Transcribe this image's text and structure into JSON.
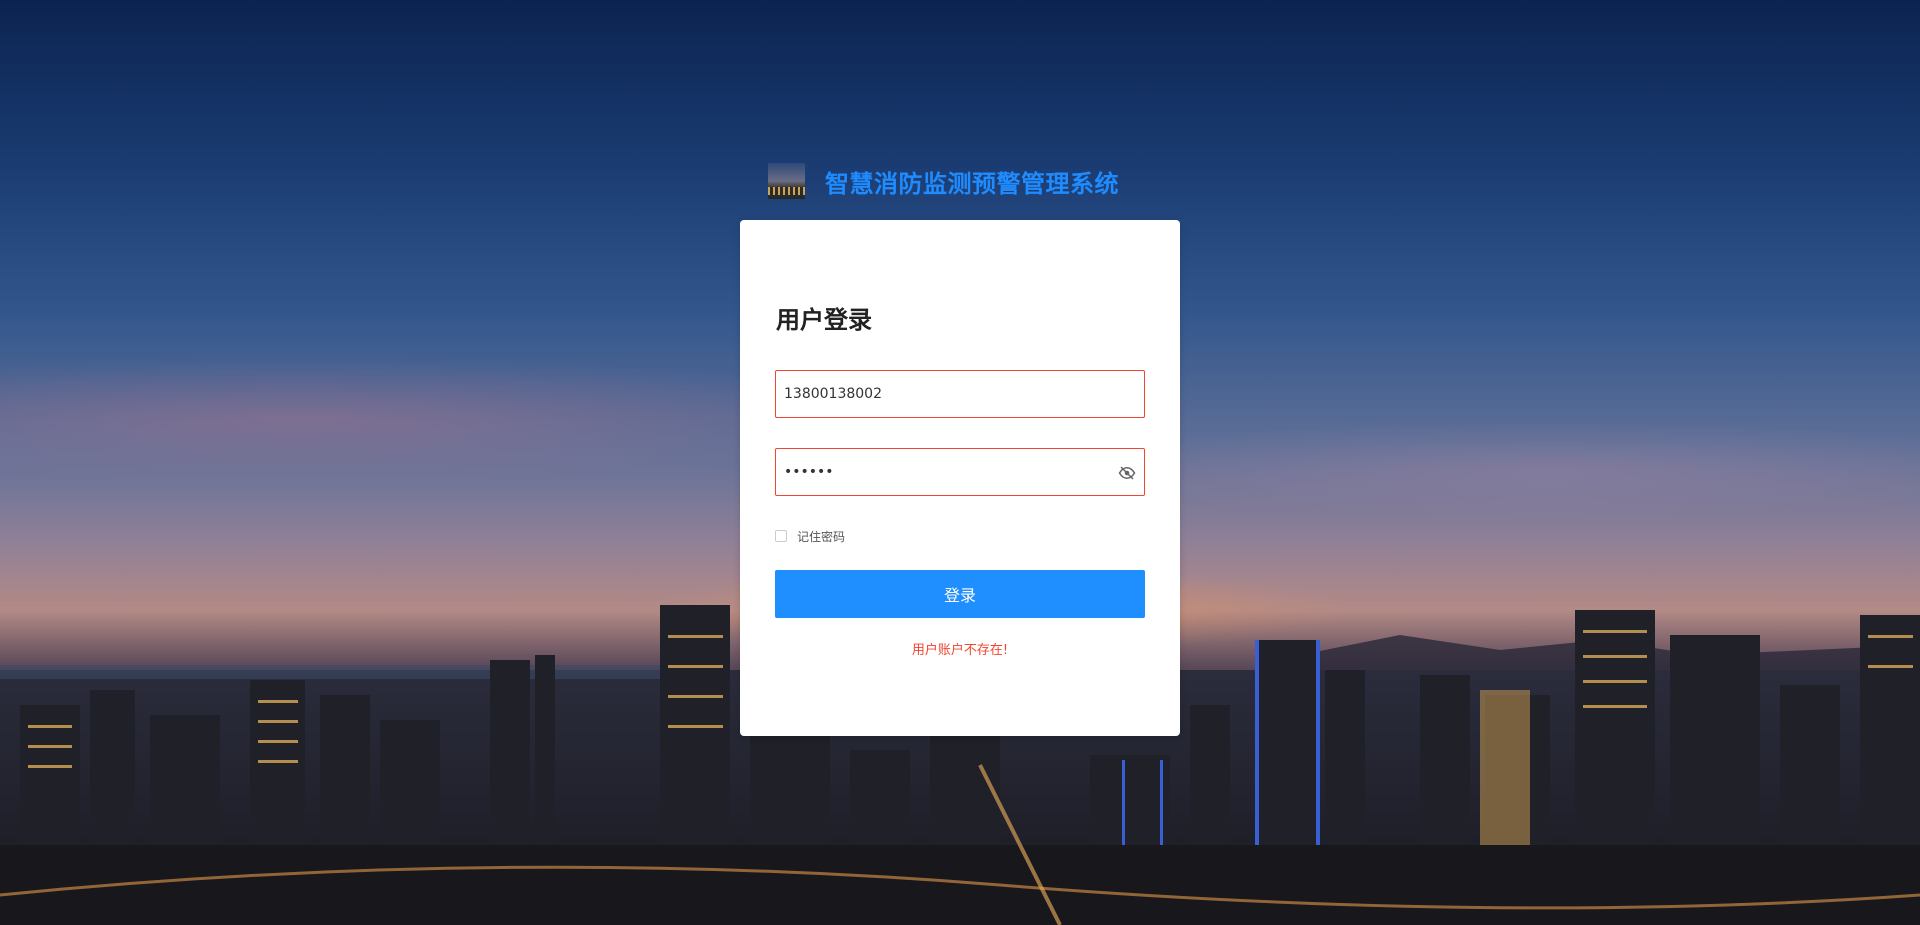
{
  "brand": {
    "title": "智慧消防监测预警管理系统",
    "logo_icon": "city-thumbnail-logo",
    "title_color": "#1e8bff"
  },
  "login": {
    "heading": "用户登录",
    "username_value": "13800138002",
    "password_mask": "••••••",
    "password_toggle_icon": "eye-off-icon",
    "remember_label": "记住密码",
    "remember_checked": false,
    "submit_label": "登录",
    "error_message": "用户账户不存在!",
    "error_color": "#f0452f",
    "button_color": "#1f8efe"
  },
  "background": {
    "description_icon": "city-night-skyline-background"
  }
}
